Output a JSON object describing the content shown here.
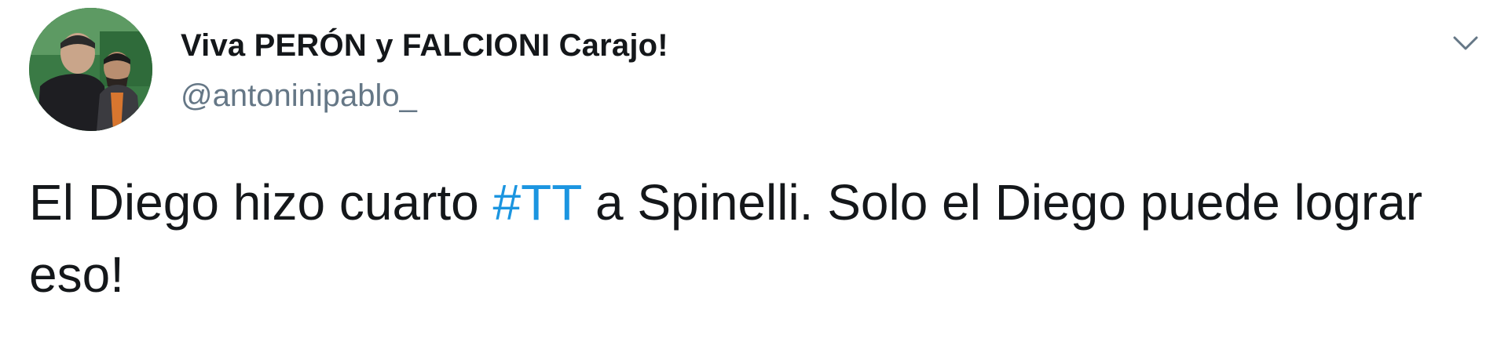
{
  "tweet": {
    "author": {
      "display_name": "Viva PERÓN y FALCIONI Carajo!",
      "handle": "@antoninipablo_",
      "avatar_icon": "profile-photo"
    },
    "menu_icon": "chevron-down-icon",
    "text": {
      "part1": "El Diego hizo cuarto",
      "hashtag": "#TT",
      "part2": "a Spinelli. Solo el Diego puede lograr eso!"
    }
  },
  "colors": {
    "text": "#14171a",
    "secondary": "#657786",
    "link": "#1b95e0",
    "background": "#ffffff"
  }
}
